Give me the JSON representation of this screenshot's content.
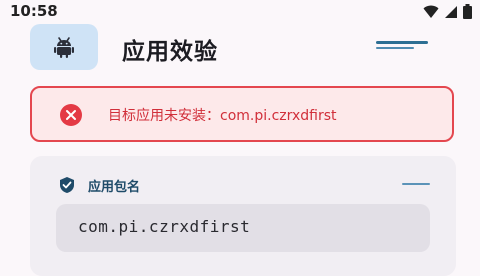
{
  "status_bar": {
    "time": "10:58",
    "icons": [
      "wifi-icon",
      "cellular-signal-icon",
      "battery-icon"
    ]
  },
  "header": {
    "title": "应用效验",
    "app_icon": "android-icon",
    "menu_icon": "menu-lines-icon"
  },
  "error": {
    "icon": "error-circle-icon",
    "message": "目标应用未安装：com.pi.czrxdfirst",
    "color": "#d12f3a"
  },
  "package_card": {
    "icon": "shield-check-icon",
    "label": "应用包名",
    "value": "com.pi.czrxdfirst"
  },
  "colors": {
    "background": "#fbf7fa",
    "accent": "#2d6f93",
    "error_bg": "#fde9ea",
    "error_border": "#e4474f"
  }
}
